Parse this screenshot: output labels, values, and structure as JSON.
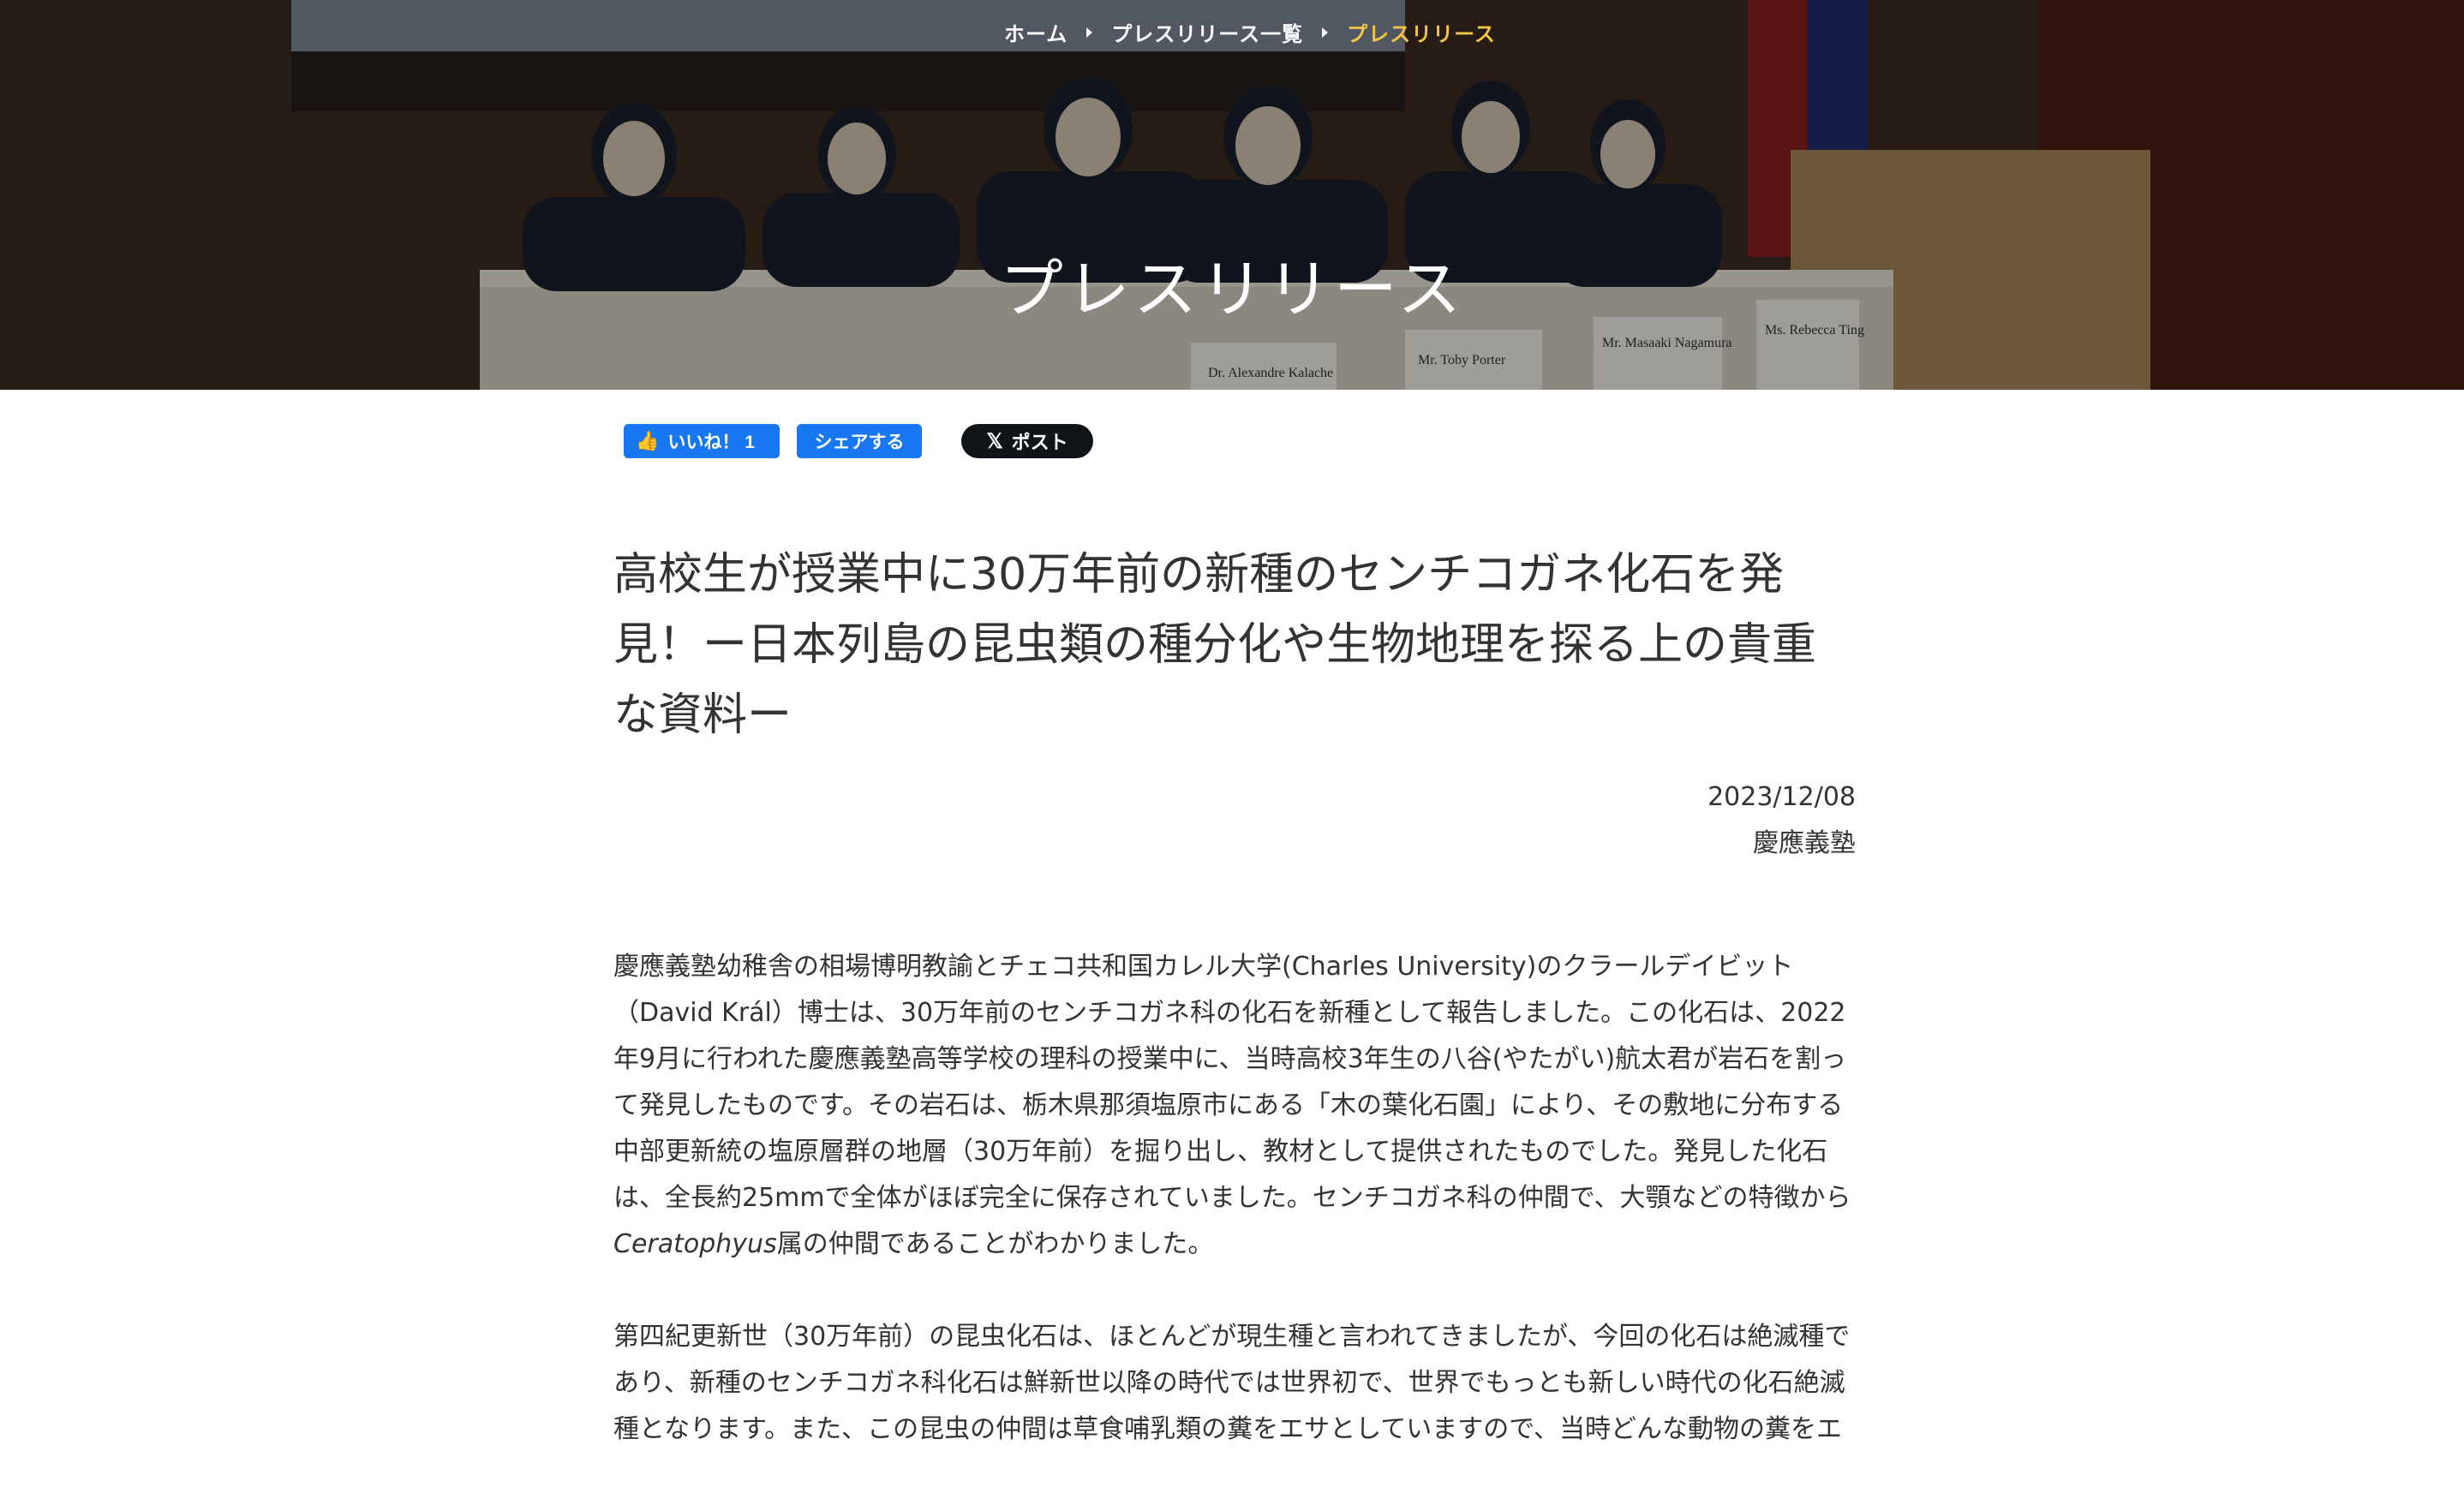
{
  "hero": {
    "breadcrumb": {
      "home": "ホーム",
      "list": "プレスリリース一覧",
      "current": "プレスリリース"
    },
    "title": "プレスリリース",
    "photo_placards": [
      "Dr. Alexandre Kalache",
      "Mr. Toby Porter",
      "Mr. Masaaki Nagamura",
      "Ms. Rebecca Ting"
    ]
  },
  "social": {
    "like_label": "いいね！ 1",
    "share_label": "シェアする",
    "post_label": "ポスト"
  },
  "article": {
    "title": "高校生が授業中に30万年前の新種のセンチコガネ化石を発見！ー日本列島の昆虫類の種分化や生物地理を探る上の貴重な資料ー",
    "date": "2023/12/08",
    "author": "慶應義塾",
    "paragraph1_main": "慶應義塾幼稚舎の相場博明教諭とチェコ共和国カレル大学(Charles University)のクラールデイビット（David Král）博士は、30万年前のセンチコガネ科の化石を新種として報告しました。この化石は、2022年9月に行われた慶應義塾高等学校の理科の授業中に、当時高校3年生の八谷(やたがい)航太君が岩石を割って発見したものです。その岩石は、栃木県那須塩原市にある「木の葉化石園」により、その敷地に分布する中部更新統の塩原層群の地層（30万年前）を掘り出し、教材として提供されたものでした。発見した化石は、全長約25mmで全体がほぼ完全に保存されていました。センチコガネ科の仲間で、大顎などの特徴から",
    "paragraph1_genus": "Ceratophyus",
    "paragraph1_tail": "属の仲間であることがわかりました。",
    "paragraph2": "第四紀更新世（30万年前）の昆虫化石は、ほとんどが現生種と言われてきましたが、今回の化石は絶滅種であり、新種のセンチコガネ科化石は鮮新世以降の時代では世界初で、世界でもっとも新しい時代の化石絶滅種となります。また、この昆虫の仲間は草食哺乳類の糞をエサとしていますので、当時どんな動物の糞をエ"
  }
}
